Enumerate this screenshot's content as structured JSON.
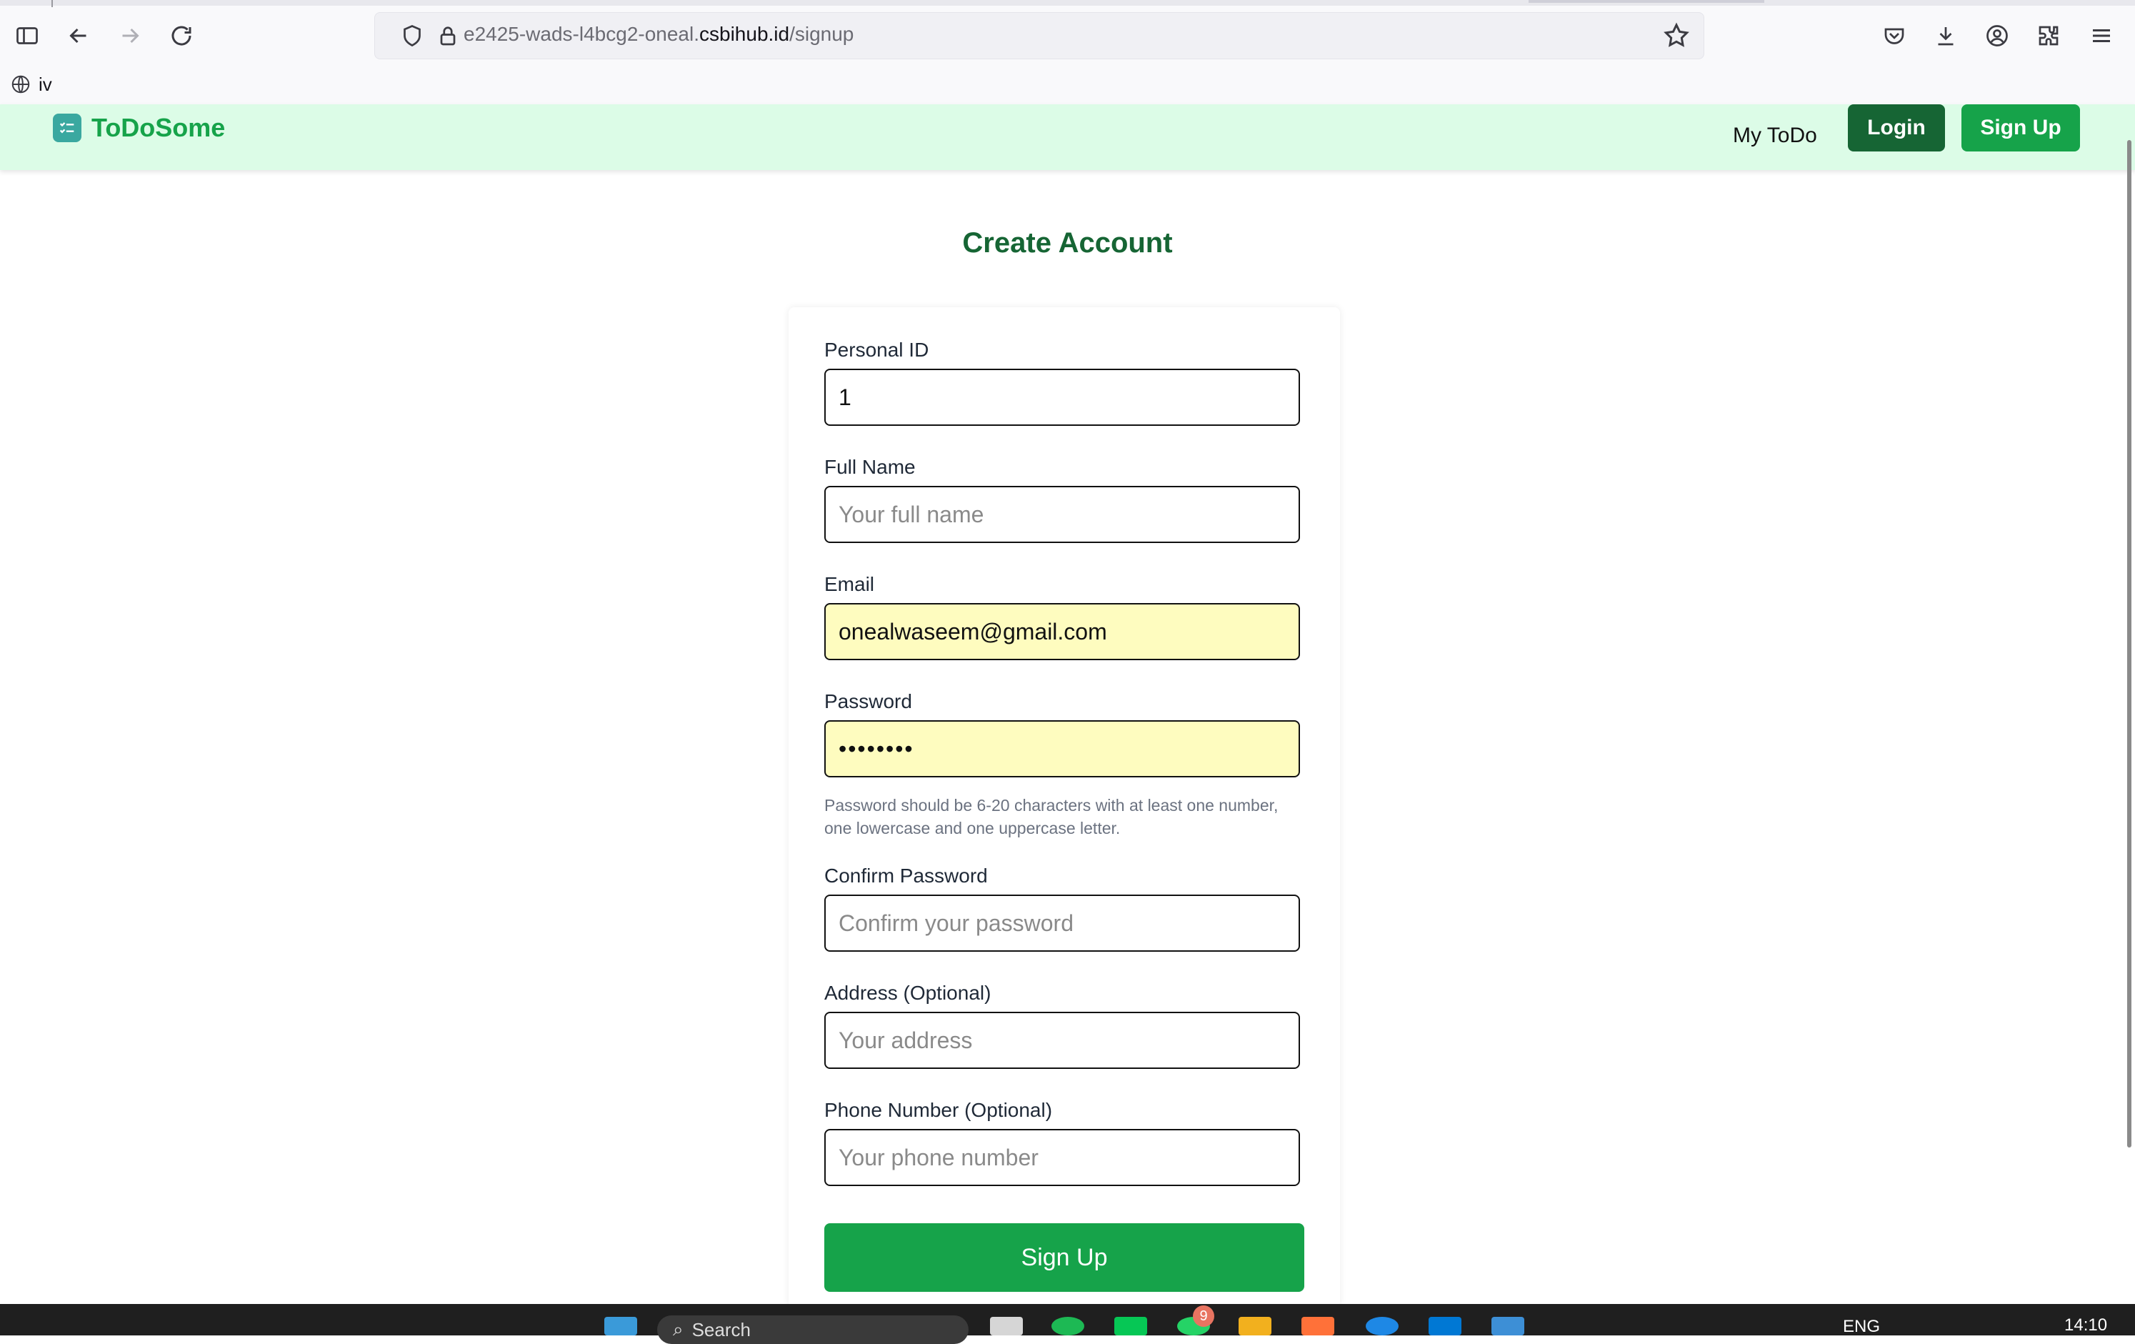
{
  "browser": {
    "url_prefix": "e2425-wads-l4bcg2-oneal.",
    "url_domain": "csbihub.id",
    "url_path": "/signup",
    "bookmark_label": "iv"
  },
  "header": {
    "brand": "ToDoSome",
    "nav_mytodo": "My ToDo",
    "login": "Login",
    "signup": "Sign Up",
    "colors": {
      "header_bg": "#dcfce7",
      "brand": "#16a34a",
      "login_bg": "#166534",
      "signup_bg": "#16a34a"
    }
  },
  "form": {
    "title": "Create Account",
    "personal_id": {
      "label": "Personal ID",
      "value": "1"
    },
    "full_name": {
      "label": "Full Name",
      "placeholder": "Your full name"
    },
    "email": {
      "label": "Email",
      "value": "onealwaseem@gmail.com"
    },
    "password": {
      "label": "Password",
      "value": "••••••••"
    },
    "password_hint": "Password should be 6-20 characters with at least one number, one lowercase and one uppercase letter.",
    "confirm_password": {
      "label": "Confirm Password",
      "placeholder": "Confirm your password"
    },
    "address": {
      "label": "Address (Optional)",
      "placeholder": "Your address"
    },
    "phone": {
      "label": "Phone Number (Optional)",
      "placeholder": "Your phone number"
    },
    "submit": "Sign Up"
  },
  "taskbar": {
    "search_label": "Search",
    "badge_count": "9",
    "language": "ENG",
    "time": "14:10"
  }
}
